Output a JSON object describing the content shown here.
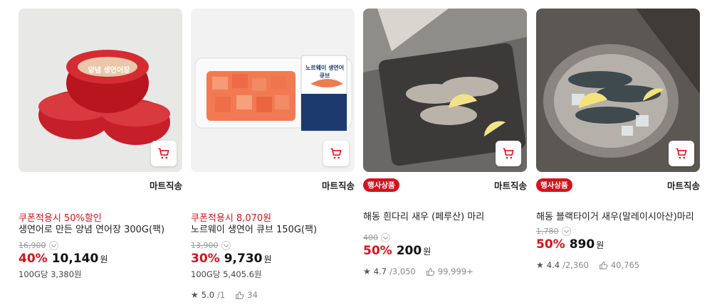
{
  "products": [
    {
      "badge": "",
      "shipping": "마트직송",
      "coupon": "쿠폰적용시 50%할인",
      "name": "생연어로 만든 양념 연어장 300G(팩)",
      "original_price": "16,900",
      "discount": "40%",
      "price": "10,140",
      "currency": "원",
      "unit_price": "100G당 3,380원",
      "rating": "",
      "rating_count": "",
      "likes": "",
      "image_label": "양념 생연어장"
    },
    {
      "badge": "",
      "shipping": "마트직송",
      "coupon": "쿠폰적용시 8,070원",
      "name": "노르웨이 생연어 큐브 150G(팩)",
      "original_price": "13,900",
      "discount": "30%",
      "price": "9,730",
      "currency": "원",
      "unit_price": "100G당 5,405.6원",
      "rating": "5.0",
      "rating_count": "/1",
      "likes": "34",
      "image_label": "노르웨이 생연어 큐브"
    },
    {
      "badge": "행사상품",
      "shipping": "마트직송",
      "coupon": "",
      "name": "해동 흰다리 새우 (페루산) 마리",
      "original_price": "400",
      "discount": "50%",
      "price": "200",
      "currency": "원",
      "unit_price": "",
      "rating": "4.7",
      "rating_count": "/3,050",
      "likes": "99,999+",
      "image_label": ""
    },
    {
      "badge": "행사상품",
      "shipping": "마트직송",
      "coupon": "",
      "name": "해동 블랙타이거 새우(말레이시아산)마리",
      "original_price": "1,780",
      "discount": "50%",
      "price": "890",
      "currency": "원",
      "unit_price": "",
      "rating": "4.4",
      "rating_count": "/2,360",
      "likes": "40,765",
      "image_label": ""
    }
  ],
  "colors": {
    "accent": "#d5121d",
    "text": "#222222",
    "muted": "#999999"
  },
  "icons": {
    "cart": "cart-icon",
    "star": "star-icon",
    "like": "thumbs-up-icon",
    "chevron": "chevron-down-icon"
  }
}
